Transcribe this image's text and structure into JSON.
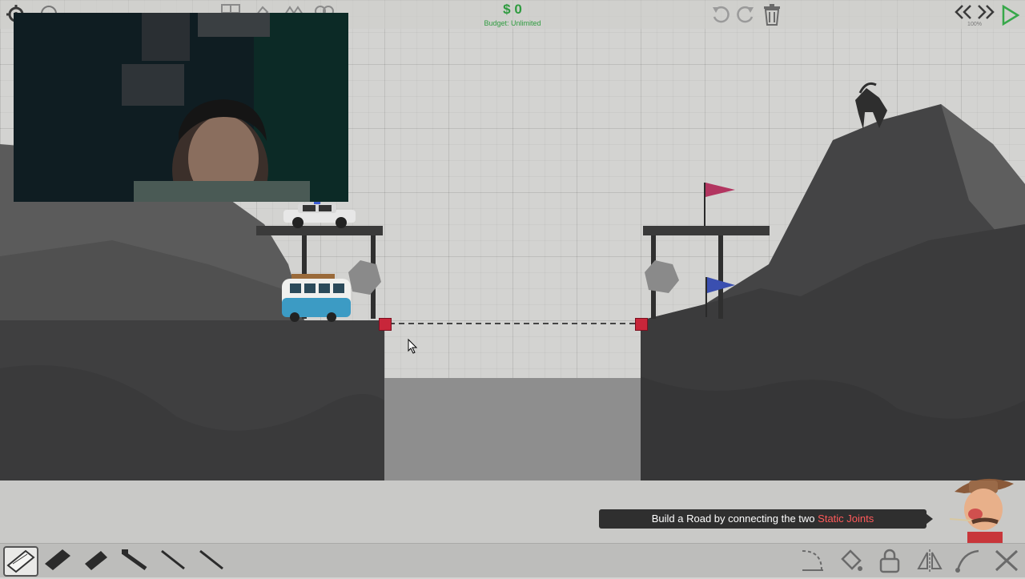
{
  "topbar": {
    "budget_amount": "$ 0",
    "budget_label": "Budget: Unlimited",
    "speed_label": "100%",
    "icons": [
      "settings-icon",
      "info-icon",
      "grid-icon",
      "paint-icon",
      "layers-icon",
      "group-icon",
      "undo-icon",
      "redo-icon",
      "trash-icon",
      "rewind-icon",
      "fast-forward-icon",
      "play-icon"
    ]
  },
  "hint": {
    "text_before": "Build a Road by connecting the two ",
    "text_accent": "Static Joints"
  },
  "bottombar": {
    "materials": [
      "road-material-icon",
      "reinforced-road-material-icon",
      "wood-material-icon",
      "steel-material-icon",
      "rope-material-icon",
      "cable-material-icon"
    ],
    "tools": [
      "curve-tool-icon",
      "paint-bucket-icon",
      "lock-icon",
      "mirror-icon",
      "curve-icon",
      "close-icon"
    ]
  },
  "colors": {
    "budget": "#2e9b3f",
    "static_joint": "#c8263a",
    "accent_text": "#ff5a5a",
    "flag_red": "#b23560",
    "flag_blue": "#3a4fb0"
  }
}
